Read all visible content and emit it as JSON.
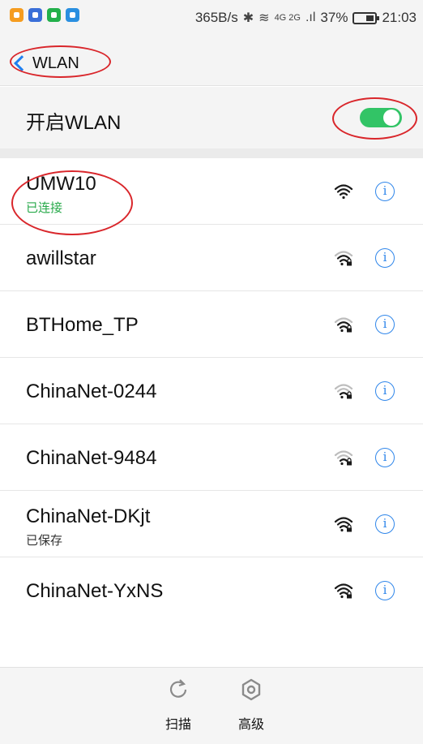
{
  "status_bar": {
    "net_speed": "365B/s",
    "bluetooth_glyph": "✱",
    "wifi_glyph": "≋",
    "network_type": "4G 2G",
    "signal_glyph": ".ıl",
    "battery_percent": "37%",
    "battery_level": 0.37,
    "time": "21:03",
    "notification_icons": [
      "app-icon-orange",
      "app-icon-blue",
      "app-icon-green",
      "app-icon-blue"
    ]
  },
  "header": {
    "back_label": "WLAN"
  },
  "wlan_toggle": {
    "label": "开启WLAN",
    "on": true
  },
  "networks": [
    {
      "ssid": "UMW10",
      "status": "已连接",
      "secured": false,
      "signal": 3
    },
    {
      "ssid": "awillstar",
      "status": "",
      "secured": true,
      "signal": 2
    },
    {
      "ssid": "BTHome_TP",
      "status": "",
      "secured": true,
      "signal": 2
    },
    {
      "ssid": "ChinaNet-0244",
      "status": "",
      "secured": true,
      "signal": 1
    },
    {
      "ssid": "ChinaNet-9484",
      "status": "",
      "secured": true,
      "signal": 1
    },
    {
      "ssid": "ChinaNet-DKjt",
      "status": "已保存",
      "secured": true,
      "signal": 3
    },
    {
      "ssid": "ChinaNet-YxNS",
      "status": "",
      "secured": true,
      "signal": 3
    }
  ],
  "info_glyph": "i",
  "bottom_bar": {
    "scan_label": "扫描",
    "advanced_label": "高级"
  },
  "colors": {
    "accent": "#2f86ea",
    "toggle_on": "#32c466",
    "connected": "#27a94a",
    "annotation": "#d9262b"
  }
}
